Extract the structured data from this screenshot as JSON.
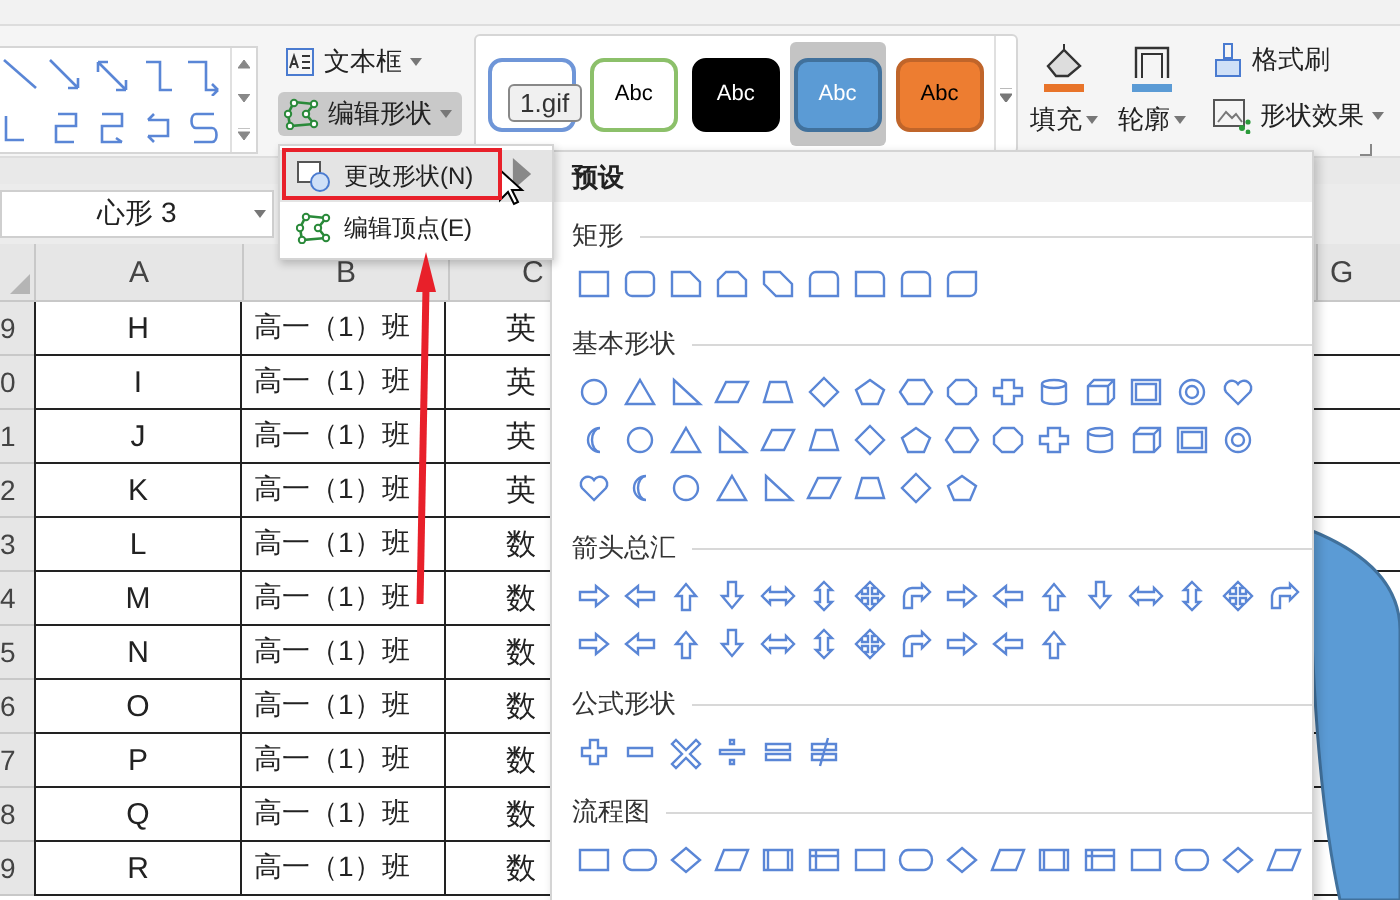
{
  "ribbon": {
    "textbox_button": "文本框",
    "edit_shape_button": "编辑形状",
    "style_swatches": [
      {
        "color": "#ffffff",
        "outline": {
          "color": "#6f96d8"
        },
        "selected": false
      },
      {
        "label": "Abc",
        "color": "#ffffff",
        "outline": {
          "color": "#8cc06a"
        },
        "selected": false
      },
      {
        "label": "Abc",
        "color": "#000000",
        "outline": {
          "color": "#000000"
        },
        "selected": false
      },
      {
        "label": "Abc",
        "color": "#5b9bd5",
        "outline": {
          "color": "#41719c"
        },
        "selected": true
      },
      {
        "label": "Abc",
        "color": "#ed7d31",
        "outline": {
          "color": "#c0652a"
        },
        "selected": false
      }
    ],
    "tooltip": "1.gif",
    "fill_button": "填充",
    "outline_button": "轮廓",
    "format_painter_button": "格式刷",
    "shape_effects_button": "形状效果"
  },
  "name_box": "心形 3",
  "sheet": {
    "columns": [
      "A",
      "B",
      "C",
      "G"
    ],
    "rows": [
      {
        "number": "9",
        "cells": [
          "H",
          "高一（1）班",
          "英"
        ]
      },
      {
        "number": "0",
        "cells": [
          "I",
          "高一（1）班",
          "英"
        ]
      },
      {
        "number": "1",
        "cells": [
          "J",
          "高一（1）班",
          "英"
        ]
      },
      {
        "number": "2",
        "cells": [
          "K",
          "高一（1）班",
          "英"
        ]
      },
      {
        "number": "3",
        "cells": [
          "L",
          "高一（1）班",
          "数"
        ]
      },
      {
        "number": "4",
        "cells": [
          "M",
          "高一（1）班",
          "数"
        ]
      },
      {
        "number": "5",
        "cells": [
          "N",
          "高一（1）班",
          "数"
        ]
      },
      {
        "number": "6",
        "cells": [
          "O",
          "高一（1）班",
          "数"
        ]
      },
      {
        "number": "7",
        "cells": [
          "P",
          "高一（1）班",
          "数"
        ]
      },
      {
        "number": "8",
        "cells": [
          "Q",
          "高一（1）班",
          "数"
        ]
      },
      {
        "number": "9",
        "cells": [
          "R",
          "高一（1）班",
          "数"
        ]
      }
    ]
  },
  "context_menu": {
    "items": [
      {
        "label": "更改形状(N)",
        "selected": true,
        "submenu": true
      },
      {
        "label": "编辑顶点(E)",
        "selected": false,
        "submenu": false
      }
    ]
  },
  "submenu": {
    "header": "预设",
    "sections": [
      {
        "title": "矩形"
      },
      {
        "title": "基本形状"
      },
      {
        "title": "箭头总汇"
      },
      {
        "title": "公式形状"
      },
      {
        "title": "流程图"
      }
    ]
  }
}
